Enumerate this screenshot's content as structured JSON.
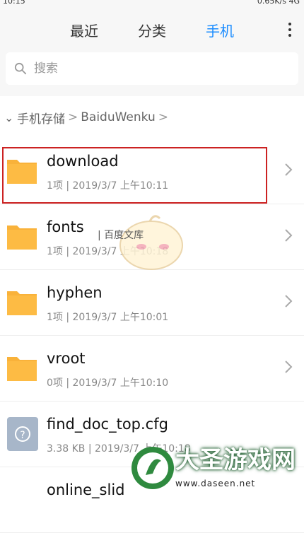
{
  "status": {
    "time": "10:15",
    "right_info": "0.65K/s  4G"
  },
  "tabs": [
    {
      "label": "最近"
    },
    {
      "label": "分类"
    },
    {
      "label": "手机"
    }
  ],
  "search": {
    "placeholder": "搜索"
  },
  "breadcrumb": {
    "root": "手机存储",
    "sep": ">",
    "current": "BaiduWenku",
    "end": ">"
  },
  "files": [
    {
      "name": "download",
      "meta": "1项 | 2019/3/7 上午10:11",
      "type": "folder"
    },
    {
      "name": "fonts",
      "meta": "1项 | 2019/3/7 上午10:18",
      "type": "folder"
    },
    {
      "name": "hyphen",
      "meta": "1项 | 2019/3/7 上午10:01",
      "type": "folder"
    },
    {
      "name": "vroot",
      "meta": "0项 | 2019/3/7 上午10:10",
      "type": "folder"
    },
    {
      "name": "find_doc_top.cfg",
      "meta": "3.38 KB | 2019/3/7 上午10:18",
      "type": "file"
    },
    {
      "name": "online_slid",
      "meta": "",
      "type": "file"
    }
  ],
  "overlay": {
    "label": "| 百度文库"
  },
  "watermark": {
    "title": "大圣游戏网",
    "url": "www.daseen.net"
  },
  "colors": {
    "accent": "#1a8cff",
    "folder": "#f9b23a",
    "highlight": "#cc2222"
  }
}
